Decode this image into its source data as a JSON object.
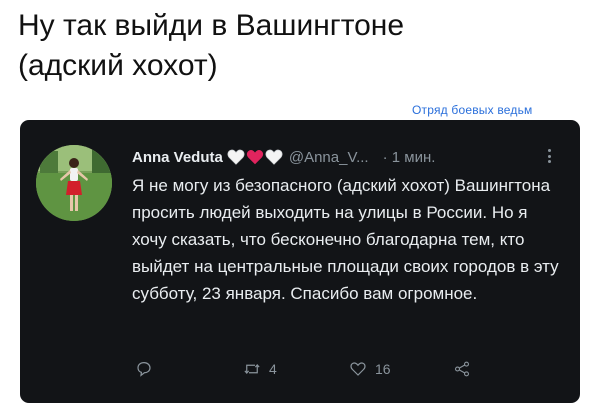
{
  "caption": {
    "line1": "Ну так выйди в Вашингтоне",
    "line2": "(адский хохот)"
  },
  "watermark": "Отряд боевых ведьм",
  "tweet": {
    "author_name": "Anna Veduta",
    "handle": "@Anna_V...",
    "time": "· 1 мин.",
    "text": "Я не могу из безопасного (адский хохот) Вашингтона просить людей выходить на улицы в России. Но я хочу сказать, что бесконечно благодарна тем, кто выйдет на центральные площади своих городов в эту субботу, 23 января. Спасибо вам огромное.",
    "retweets": "4",
    "likes": "16"
  },
  "icons": {
    "hearts": [
      "white-heart-icon",
      "red-heart-icon",
      "white-heart-icon"
    ],
    "reply": "reply-icon",
    "retweet": "retweet-icon",
    "like": "like-icon",
    "share": "share-icon",
    "more": "more-icon"
  },
  "colors": {
    "card_bg": "#121417",
    "text_primary": "#e9edf0",
    "text_secondary": "#8a949c",
    "watermark": "#2a6fdb",
    "heart_red": "#e0245e"
  }
}
